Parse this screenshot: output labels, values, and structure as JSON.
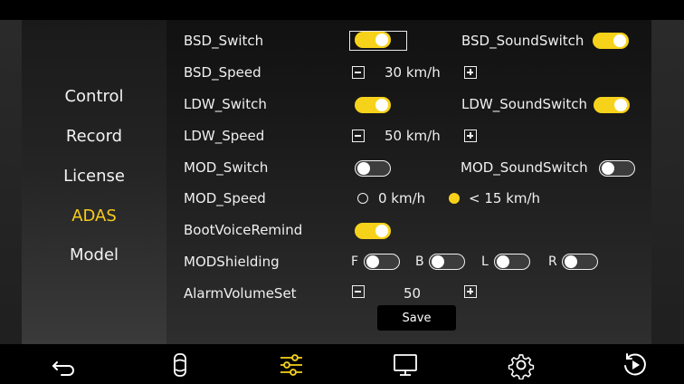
{
  "sidebar": {
    "items": [
      {
        "label": "Control"
      },
      {
        "label": "Record"
      },
      {
        "label": "License"
      },
      {
        "label": "ADAS"
      },
      {
        "label": "Model"
      }
    ],
    "active": "ADAS"
  },
  "settings": {
    "bsd_switch": {
      "label": "BSD_Switch",
      "state": "on"
    },
    "bsd_sound_switch": {
      "label": "BSD_SoundSwitch",
      "state": "on"
    },
    "bsd_speed": {
      "label": "BSD_Speed",
      "value": "30 km/h"
    },
    "ldw_switch": {
      "label": "LDW_Switch",
      "state": "on"
    },
    "ldw_sound_switch": {
      "label": "LDW_SoundSwitch",
      "state": "on"
    },
    "ldw_speed": {
      "label": "LDW_Speed",
      "value": "50 km/h"
    },
    "mod_switch": {
      "label": "MOD_Switch",
      "state": "off"
    },
    "mod_sound_switch": {
      "label": "MOD_SoundSwitch",
      "state": "off"
    },
    "mod_speed": {
      "label": "MOD_Speed",
      "option_a": "0 km/h",
      "option_b": "< 15 km/h",
      "selected": "< 15 km/h"
    },
    "boot_voice_remind": {
      "label": "BootVoiceRemind",
      "state": "on"
    },
    "mod_shielding": {
      "label": "MODShielding",
      "f": "F",
      "b": "B",
      "l": "L",
      "r": "R"
    },
    "alarm_volume": {
      "label": "AlarmVolumeSet",
      "value": "50"
    }
  },
  "save_label": "Save",
  "colors": {
    "accent": "#f7d21a",
    "text": "#f0f0f0",
    "background": "#1e1e1e"
  },
  "bottom_icons": [
    "back-icon",
    "car-icon",
    "sliders-icon",
    "monitor-icon",
    "gear-icon",
    "replay-icon"
  ]
}
